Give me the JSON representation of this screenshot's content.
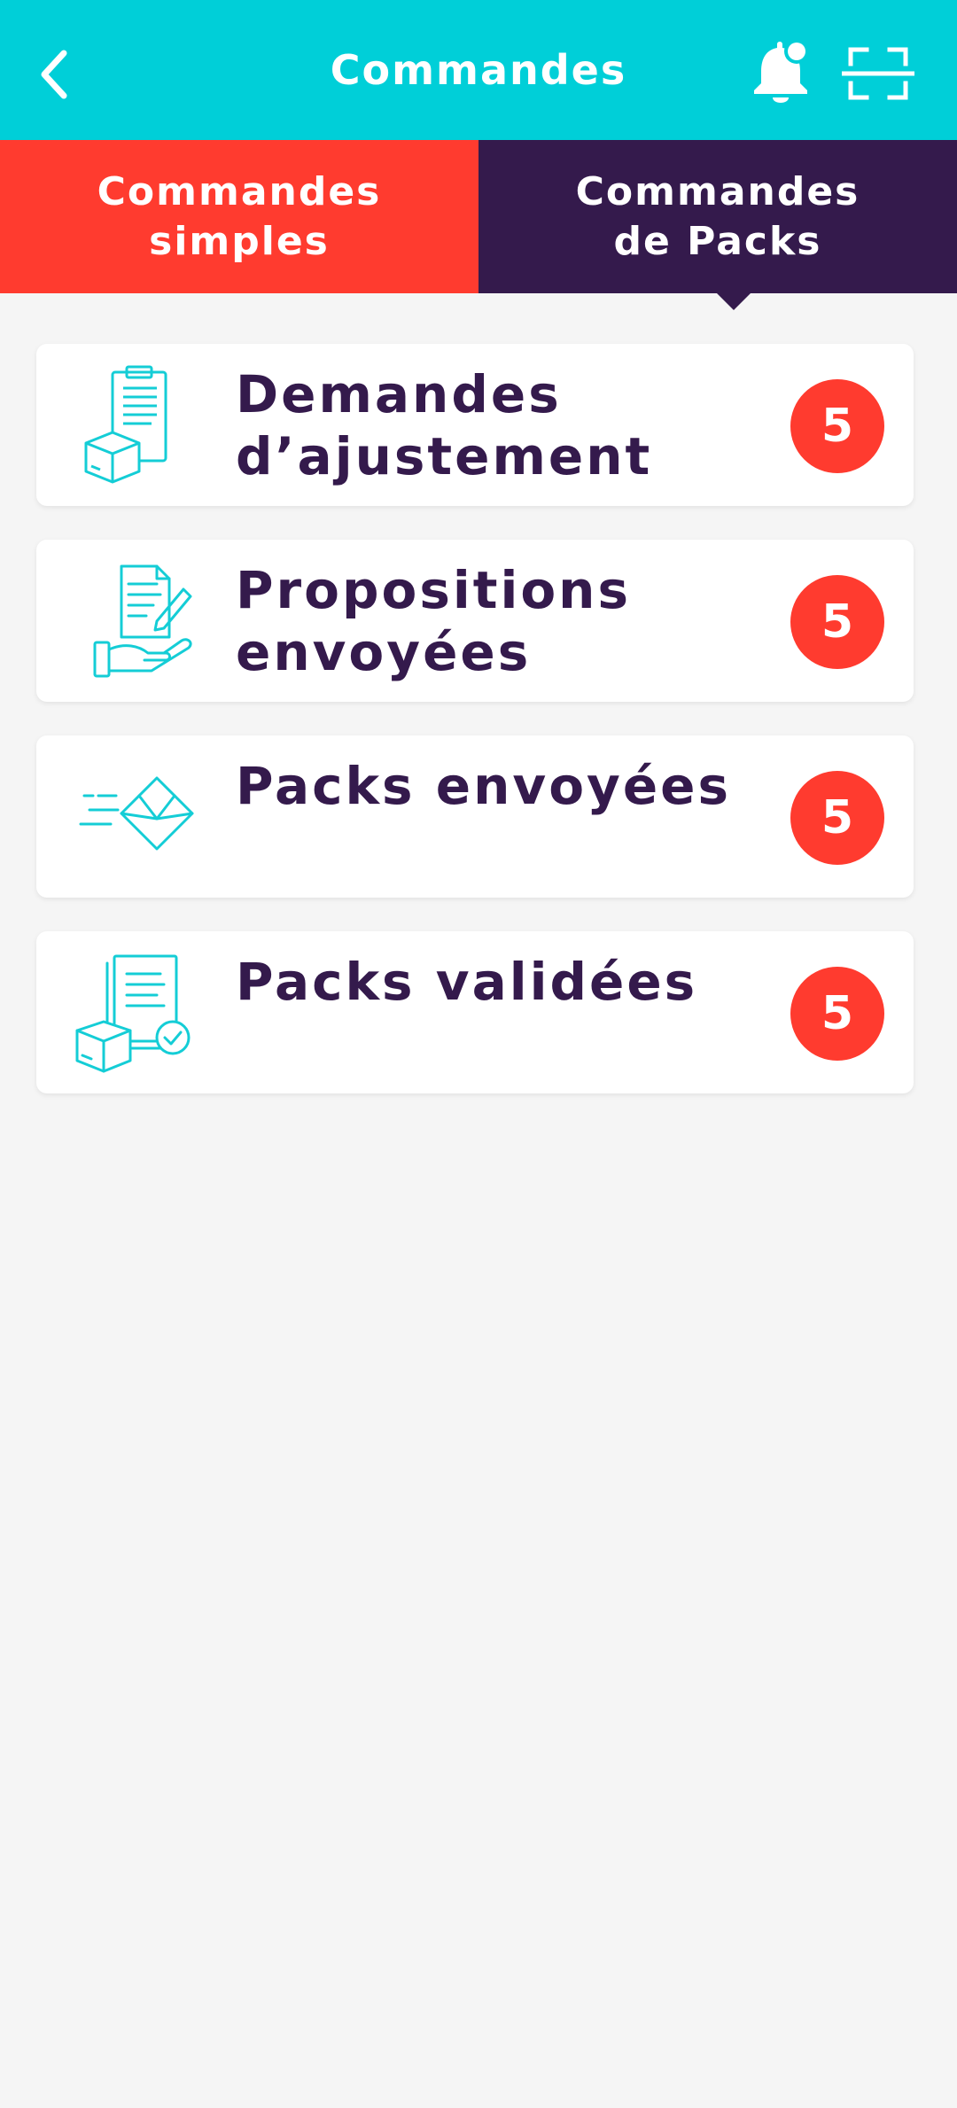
{
  "header": {
    "title": "Commandes",
    "back_icon": "chevron-left-icon",
    "bell_icon": "bell-icon",
    "scan_icon": "scan-icon"
  },
  "tabs": [
    {
      "label": "Commandes simples",
      "active": false
    },
    {
      "label": "Commandes de Packs",
      "active": true
    }
  ],
  "items": [
    {
      "label": "Demandes d’ajustement",
      "count": "5",
      "icon": "clipboard-box-icon"
    },
    {
      "label": "Propositions envoyées",
      "count": "5",
      "icon": "hand-document-icon"
    },
    {
      "label": "Packs envoyées",
      "count": "5",
      "icon": "envelope-icon"
    },
    {
      "label": "Packs validées",
      "count": "5",
      "icon": "document-box-check-icon"
    }
  ],
  "colors": {
    "header_bg": "#00cfd8",
    "tab_simple_bg": "#ff3b2f",
    "tab_packs_bg": "#341a4c",
    "badge_bg": "#ff3b2f",
    "text_dark": "#341a4c",
    "icon_accent": "#14cdd6",
    "page_bg": "#f5f5f5"
  }
}
